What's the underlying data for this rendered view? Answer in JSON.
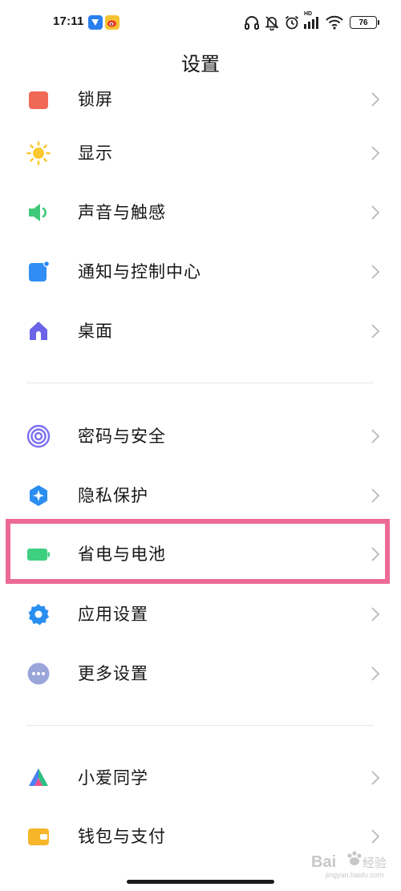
{
  "status_bar": {
    "time": "17:11",
    "battery_level": "76",
    "hd_label": "HD",
    "notification_icons": [
      "message-app-icon",
      "weibo-icon"
    ],
    "indicator_icons": [
      "headphone-icon",
      "mute-bell-icon",
      "alarm-icon",
      "signal-icon",
      "wifi-icon",
      "battery-icon"
    ]
  },
  "header": {
    "title": "设置"
  },
  "settings": {
    "items": [
      {
        "label": "锁屏",
        "icon": "lock-screen-icon",
        "color": "#f06856"
      },
      {
        "label": "显示",
        "icon": "sun-icon",
        "color": "#fbc830"
      },
      {
        "label": "声音与触感",
        "icon": "speaker-icon",
        "color": "#3ec97a"
      },
      {
        "label": "通知与控制中心",
        "icon": "notification-icon",
        "color": "#2f8df5"
      },
      {
        "label": "桌面",
        "icon": "home-icon",
        "color": "#6c63e8"
      },
      {
        "label": "密码与安全",
        "icon": "fingerprint-icon",
        "color": "#7b6ff0"
      },
      {
        "label": "隐私保护",
        "icon": "privacy-shield-icon",
        "color": "#2a8df2"
      },
      {
        "label": "省电与电池",
        "icon": "battery-icon",
        "color": "#3ecf80"
      },
      {
        "label": "应用设置",
        "icon": "gear-icon",
        "color": "#2a8ef0"
      },
      {
        "label": "更多设置",
        "icon": "more-dots-icon",
        "color": "#9aa6d9"
      },
      {
        "label": "小爱同学",
        "icon": "xiaoai-icon",
        "color": "#4c7ff2"
      },
      {
        "label": "钱包与支付",
        "icon": "wallet-icon",
        "color": "#f5b629"
      }
    ]
  },
  "highlight": {
    "target": "省电与电池",
    "color": "#ec6a96"
  },
  "watermark": {
    "brand": "Bai",
    "brand_suffix": "经验",
    "domain": "jingyan.baidu.com"
  }
}
